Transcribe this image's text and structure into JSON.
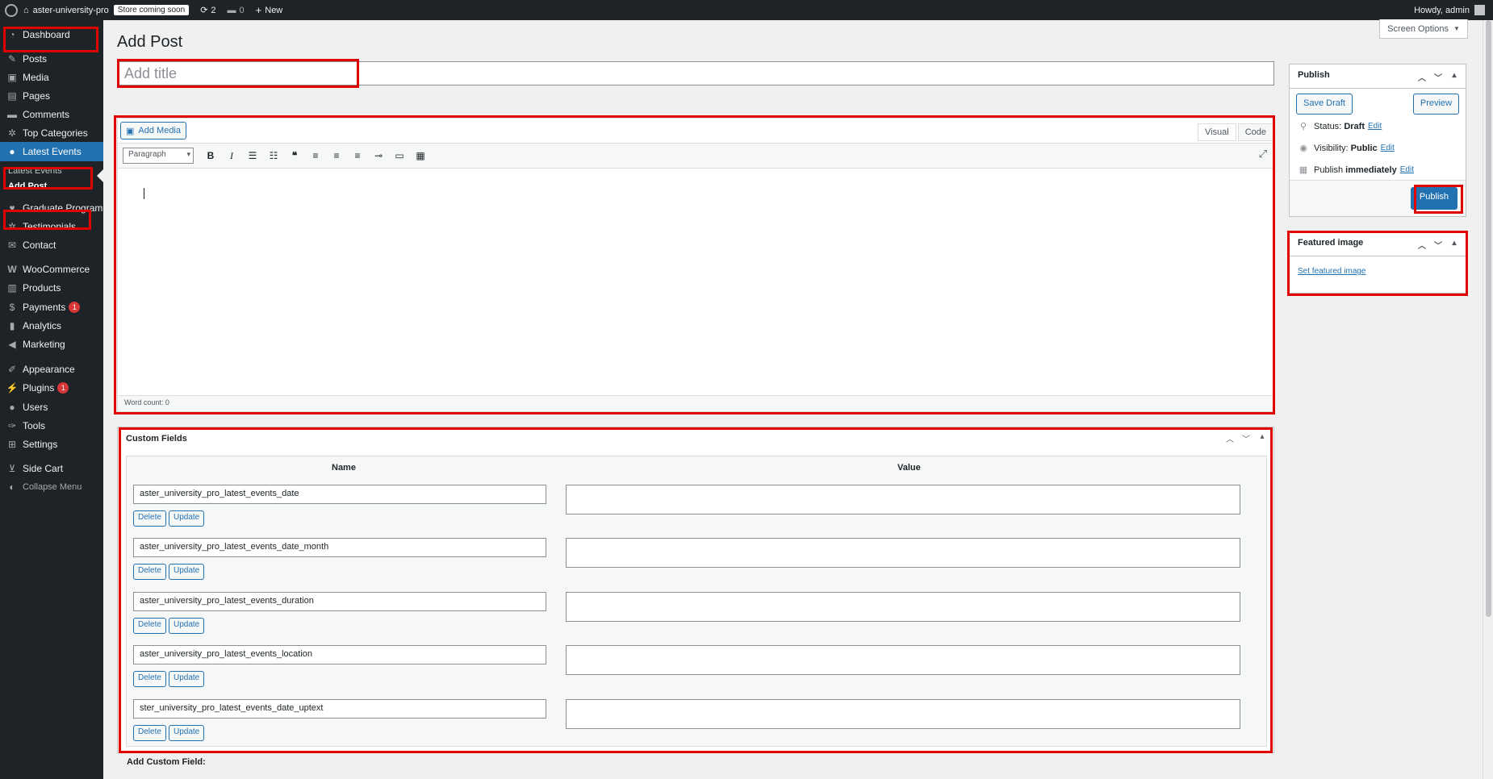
{
  "admin_bar": {
    "site_name": "aster-university-pro",
    "store_badge": "Store coming soon",
    "updates_count": "2",
    "comments_count": "0",
    "new_label": "New",
    "greeting": "Howdy, admin"
  },
  "sidebar": {
    "items": [
      {
        "label": "Dashboard",
        "icon": "dashboard-icon"
      },
      {
        "label": "Posts",
        "icon": "pin-icon"
      },
      {
        "label": "Media",
        "icon": "media-icon"
      },
      {
        "label": "Pages",
        "icon": "pages-icon"
      },
      {
        "label": "Comments",
        "icon": "comment-icon"
      },
      {
        "label": "Top Categories",
        "icon": "gear-icon"
      },
      {
        "label": "Latest Events",
        "icon": "user-icon"
      },
      {
        "label": "Graduate Program",
        "icon": "heart-icon"
      },
      {
        "label": "Testimonials",
        "icon": "gear-icon"
      },
      {
        "label": "Contact",
        "icon": "mail-icon"
      },
      {
        "label": "WooCommerce",
        "icon": "woo-icon"
      },
      {
        "label": "Products",
        "icon": "archive-icon"
      },
      {
        "label": "Payments",
        "icon": "money-icon",
        "badge": "1"
      },
      {
        "label": "Analytics",
        "icon": "chart-icon"
      },
      {
        "label": "Marketing",
        "icon": "megaphone-icon"
      },
      {
        "label": "Appearance",
        "icon": "brush-icon"
      },
      {
        "label": "Plugins",
        "icon": "plug-icon",
        "badge": "1"
      },
      {
        "label": "Users",
        "icon": "users-icon"
      },
      {
        "label": "Tools",
        "icon": "wrench-icon"
      },
      {
        "label": "Settings",
        "icon": "settings-icon"
      },
      {
        "label": "Side Cart",
        "icon": "cart-icon"
      },
      {
        "label": "Collapse Menu",
        "icon": "collapse-icon"
      }
    ],
    "submenu": [
      "Latest Events",
      "Add Post"
    ]
  },
  "page": {
    "title": "Add Post",
    "screen_options": "Screen Options",
    "title_placeholder": "Add title"
  },
  "editor": {
    "add_media": "Add Media",
    "tab_visual": "Visual",
    "tab_code": "Code",
    "format_select": "Paragraph",
    "word_count": "Word count: 0"
  },
  "custom_fields": {
    "heading": "Custom Fields",
    "col_name": "Name",
    "col_value": "Value",
    "delete_label": "Delete",
    "update_label": "Update",
    "rows": [
      {
        "name": "aster_university_pro_latest_events_date",
        "value": ""
      },
      {
        "name": "aster_university_pro_latest_events_date_month",
        "value": ""
      },
      {
        "name": "aster_university_pro_latest_events_duration",
        "value": ""
      },
      {
        "name": "aster_university_pro_latest_events_location",
        "value": ""
      },
      {
        "name": "ster_university_pro_latest_events_date_uptext",
        "value": ""
      }
    ],
    "add_heading": "Add Custom Field:"
  },
  "publish": {
    "heading": "Publish",
    "save_draft": "Save Draft",
    "preview": "Preview",
    "status_label": "Status:",
    "status_value": "Draft",
    "visibility_label": "Visibility:",
    "visibility_value": "Public",
    "schedule_label": "Publish",
    "schedule_value": "immediately",
    "edit": "Edit",
    "publish_button": "Publish"
  },
  "featured_image": {
    "heading": "Featured image",
    "link": "Set featured image"
  },
  "colors": {
    "accent": "#2271b1",
    "sidebar_bg": "#1d2327",
    "highlight_border": "#e00000",
    "badge": "#d63638"
  }
}
